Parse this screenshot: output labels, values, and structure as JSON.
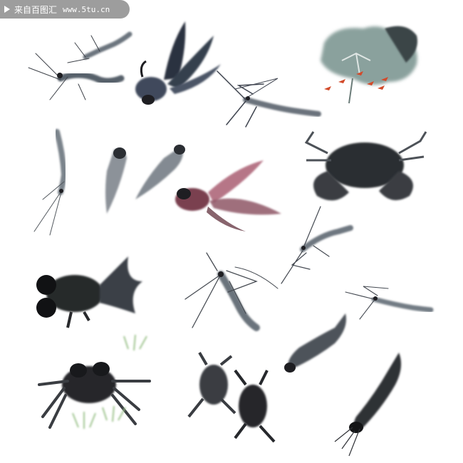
{
  "watermark": {
    "title": "来自百图汇",
    "url": "www.5tu.cn",
    "colors": {
      "background": "#9d9d9d",
      "text": "#ffffff"
    }
  },
  "artwork": {
    "style": "chinese ink wash painting",
    "subjects": [
      "shrimp",
      "goldfish",
      "shrimp",
      "lotus-leaf-with-red-fish",
      "shrimp",
      "small-fish",
      "small-fish",
      "goldfish",
      "crab",
      "shrimp",
      "goldfish",
      "shrimp",
      "shrimp",
      "fish",
      "crab-with-grass",
      "crabs",
      "catfish"
    ],
    "colors": {
      "ink_dark": "#1e1e22",
      "ink_mid": "#4a4e55",
      "ink_light": "#8d939a",
      "lotus_leaf": "#7f9894",
      "red_fish": "#d24a2a",
      "goldfish_red": "#a5546a",
      "grass_green": "#9fc48f"
    }
  }
}
